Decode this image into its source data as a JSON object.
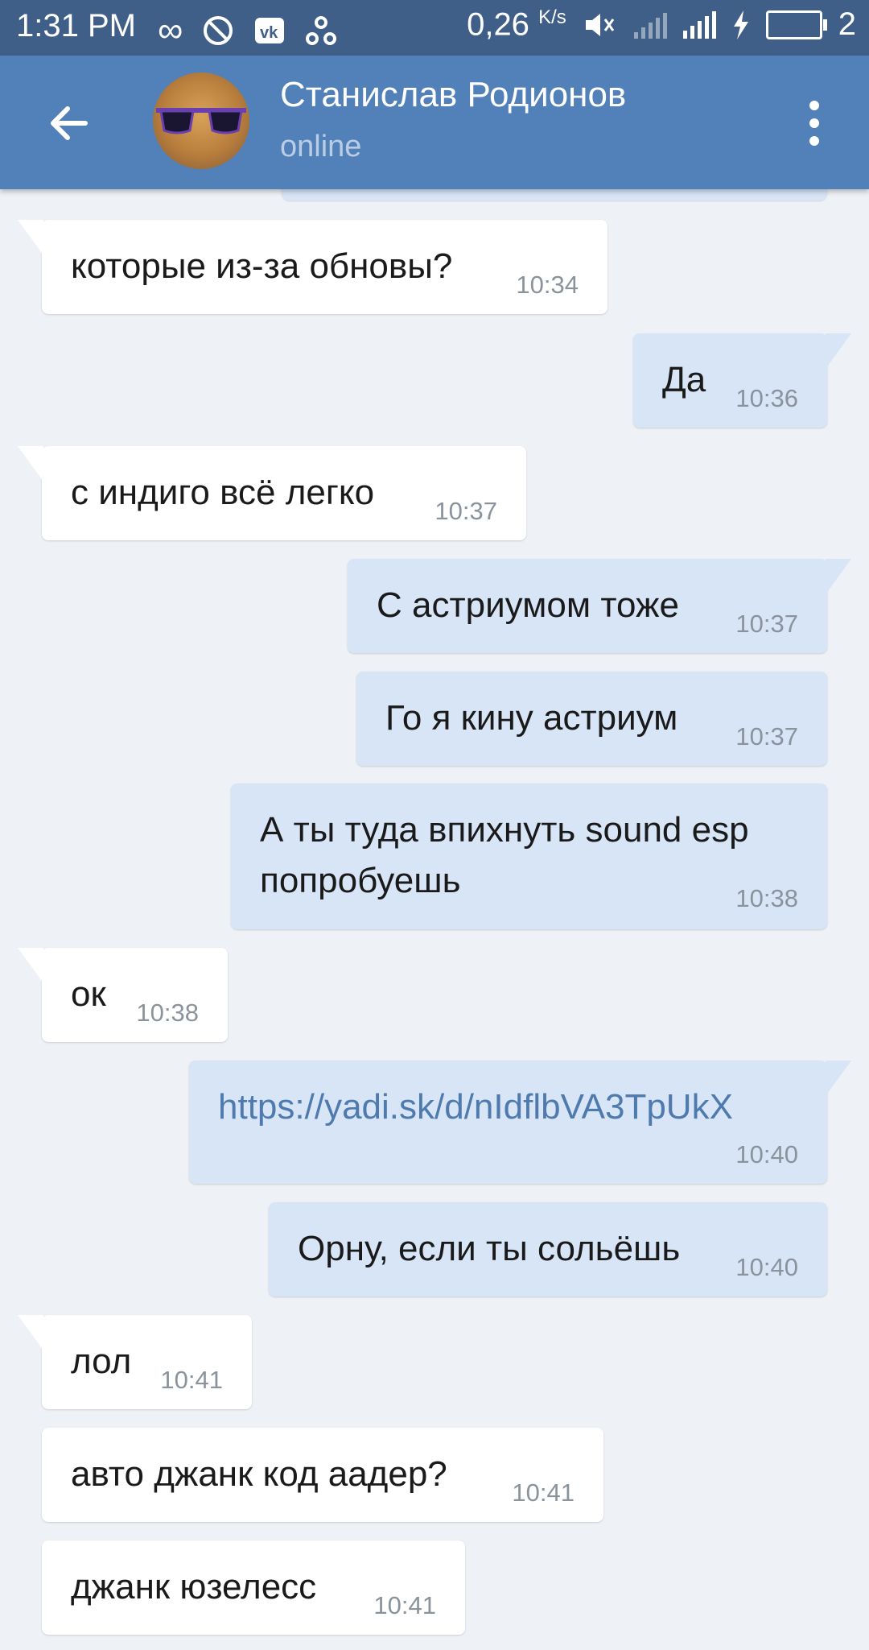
{
  "status_bar": {
    "time": "1:31 PM",
    "speed": "0,26",
    "speed_unit": "K/s",
    "battery_level": "2",
    "icons": [
      "infinity-icon",
      "blocked-icon",
      "vk-icon",
      "network-icon",
      "mute-icon",
      "signal-icon",
      "charging-icon",
      "battery-icon"
    ]
  },
  "header": {
    "name": "Станислав Родионов",
    "status": "online"
  },
  "messages": [
    {
      "dir": "in",
      "text": "которые из-за обновы?",
      "time": "10:34"
    },
    {
      "dir": "out",
      "text": "Да",
      "time": "10:36"
    },
    {
      "dir": "in",
      "text": "с индиго всё легко",
      "time": "10:37"
    },
    {
      "dir": "out",
      "text": "С астриумом тоже",
      "time": "10:37"
    },
    {
      "dir": "out",
      "text": "Го я кину астриум",
      "time": "10:37"
    },
    {
      "dir": "out",
      "text_line1": "А ты туда впихнуть sound esp",
      "text_line2": "попробуешь",
      "time": "10:38"
    },
    {
      "dir": "in",
      "text": "ок",
      "time": "10:38"
    },
    {
      "dir": "out",
      "text": "https://yadi.sk/d/nIdflbVA3TpUkX",
      "time": "10:40"
    },
    {
      "dir": "out",
      "text": "Орну, если ты сольёшь",
      "time": "10:40"
    },
    {
      "dir": "in",
      "text": "лол",
      "time": "10:41"
    },
    {
      "dir": "in",
      "text": "авто джанк код аадер?",
      "time": "10:41"
    },
    {
      "dir": "in",
      "text": "джанк юзелесс",
      "time": "10:41"
    }
  ],
  "colors": {
    "status_bar": "#3f5f88",
    "header": "#5181b8",
    "background": "#eef1f5",
    "outgoing": "#d7e5f7",
    "incoming": "#ffffff",
    "link": "#4f7aad"
  }
}
